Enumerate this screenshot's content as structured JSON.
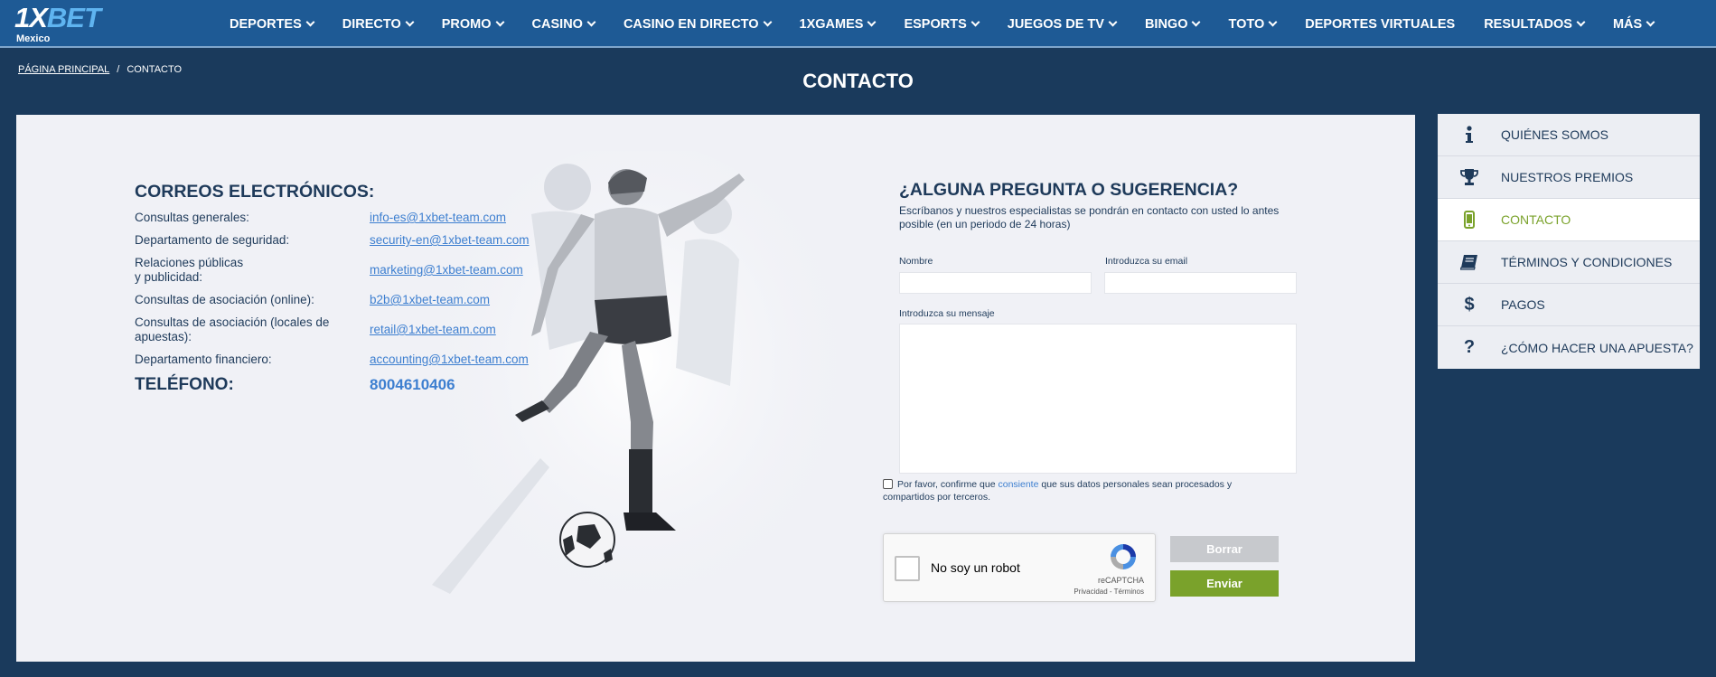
{
  "header": {
    "logo_main": "1X",
    "logo_bet": "BET",
    "logo_region": "Mexico",
    "nav": [
      {
        "label": "DEPORTES",
        "dropdown": true
      },
      {
        "label": "DIRECTO",
        "dropdown": true
      },
      {
        "label": "PROMO",
        "dropdown": true
      },
      {
        "label": "CASINO",
        "dropdown": true
      },
      {
        "label": "CASINO EN DIRECTO",
        "dropdown": true
      },
      {
        "label": "1XGAMES",
        "dropdown": true
      },
      {
        "label": "ESPORTS",
        "dropdown": true
      },
      {
        "label": "JUEGOS DE TV",
        "dropdown": true
      },
      {
        "label": "BINGO",
        "dropdown": true
      },
      {
        "label": "TOTO",
        "dropdown": true
      },
      {
        "label": "DEPORTES VIRTUALES",
        "dropdown": false
      },
      {
        "label": "RESULTADOS",
        "dropdown": true
      },
      {
        "label": "MÁS",
        "dropdown": true
      }
    ]
  },
  "breadcrumb": {
    "home": "PÁGINA PRINCIPAL",
    "separator": "/",
    "current": "CONTACTO"
  },
  "page_title": "CONTACTO",
  "emails": {
    "heading": "CORREOS ELECTRÓNICOS:",
    "rows": [
      {
        "label": "Consultas generales:",
        "email": "info-es@1xbet-team.com"
      },
      {
        "label": "Departamento de seguridad:",
        "email": "security-en@1xbet-team.com"
      },
      {
        "label": "Relaciones públicas\ny publicidad:",
        "email": "marketing@1xbet-team.com"
      },
      {
        "label": "Consultas de asociación (online):",
        "email": "b2b@1xbet-team.com"
      },
      {
        "label": "Consultas de asociación (locales de apuestas):",
        "email": "retail@1xbet-team.com"
      },
      {
        "label": "Departamento financiero:",
        "email": "accounting@1xbet-team.com"
      }
    ],
    "phone_label": "TELÉFONO:",
    "phone_value": "8004610406"
  },
  "form": {
    "heading": "¿ALGUNA PREGUNTA O SUGERENCIA?",
    "subtitle": "Escríbanos y nuestros especialistas se pondrán en contacto con usted lo antes posible (en un periodo de 24 horas)",
    "name_label": "Nombre",
    "name_value": "",
    "email_label": "Introduzca su email",
    "email_value": "",
    "message_label": "Introduzca su mensaje",
    "message_value": "",
    "consent_pre": "Por favor, confirme que ",
    "consent_link": "consiente",
    "consent_post": " que sus datos personales sean procesados y compartidos por terceros.",
    "consent_checked": false,
    "captcha_text": "No soy un robot",
    "captcha_brand": "reCAPTCHA",
    "captcha_links": "Privacidad - Términos",
    "clear_label": "Borrar",
    "send_label": "Enviar"
  },
  "sidebar": {
    "items": [
      {
        "label": "QUIÉNES SOMOS",
        "icon": "info-icon",
        "active": false
      },
      {
        "label": "NUESTROS PREMIOS",
        "icon": "trophy-icon",
        "active": false
      },
      {
        "label": "CONTACTO",
        "icon": "mobile-phone-icon",
        "active": true
      },
      {
        "label": "TÉRMINOS Y CONDICIONES",
        "icon": "book-icon",
        "active": false
      },
      {
        "label": "PAGOS",
        "icon": "dollar-icon",
        "active": false
      },
      {
        "label": "¿CÓMO HACER UNA APUESTA?",
        "icon": "question-icon",
        "active": false
      }
    ]
  },
  "colors": {
    "page_bg": "#1a3a5c",
    "header_bg": "#1e5a95",
    "link": "#3d7fd0",
    "accent_green": "#7aa22b"
  }
}
